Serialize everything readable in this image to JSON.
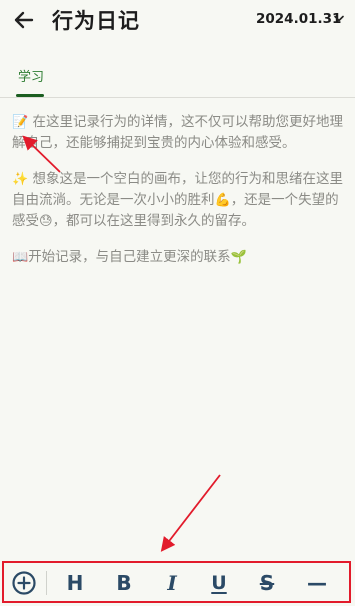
{
  "header": {
    "title": "行为日记",
    "date": "2024.01.31"
  },
  "tabs": [
    {
      "label": "学习",
      "active": true
    }
  ],
  "content": {
    "paragraph1_emoji": "📝",
    "paragraph1_text": "在这里记录行为的详情，这不仅可以帮助您更好地理解自己，还能够捕捉到宝贵的内心体验和感受。",
    "paragraph2_emoji": "✨",
    "paragraph2_text_a": "想象这是一个空白的画布，让您的行为和思绪在这里自由流淌。无论是一次小小的胜利",
    "paragraph2_emoji_a": "💪",
    "paragraph2_text_b": "，还是一个失望的感受",
    "paragraph2_emoji_b": "😓",
    "paragraph2_text_c": "，都可以在这里得到永久的留存。",
    "paragraph3_emoji": "📖",
    "paragraph3_text": "开始记录，与自己建立更深的联系",
    "paragraph3_emoji_end": "🌱"
  },
  "toolbar": {
    "add_icon": "plus-circle-icon",
    "heading": "H",
    "bold": "B",
    "italic": "I",
    "underline": "U",
    "strikethrough": "S",
    "divider": "—"
  },
  "colors": {
    "accent_green": "#2e7d32",
    "toolbar_icon": "#2b4a66",
    "annotation_red": "#e21b2b"
  }
}
